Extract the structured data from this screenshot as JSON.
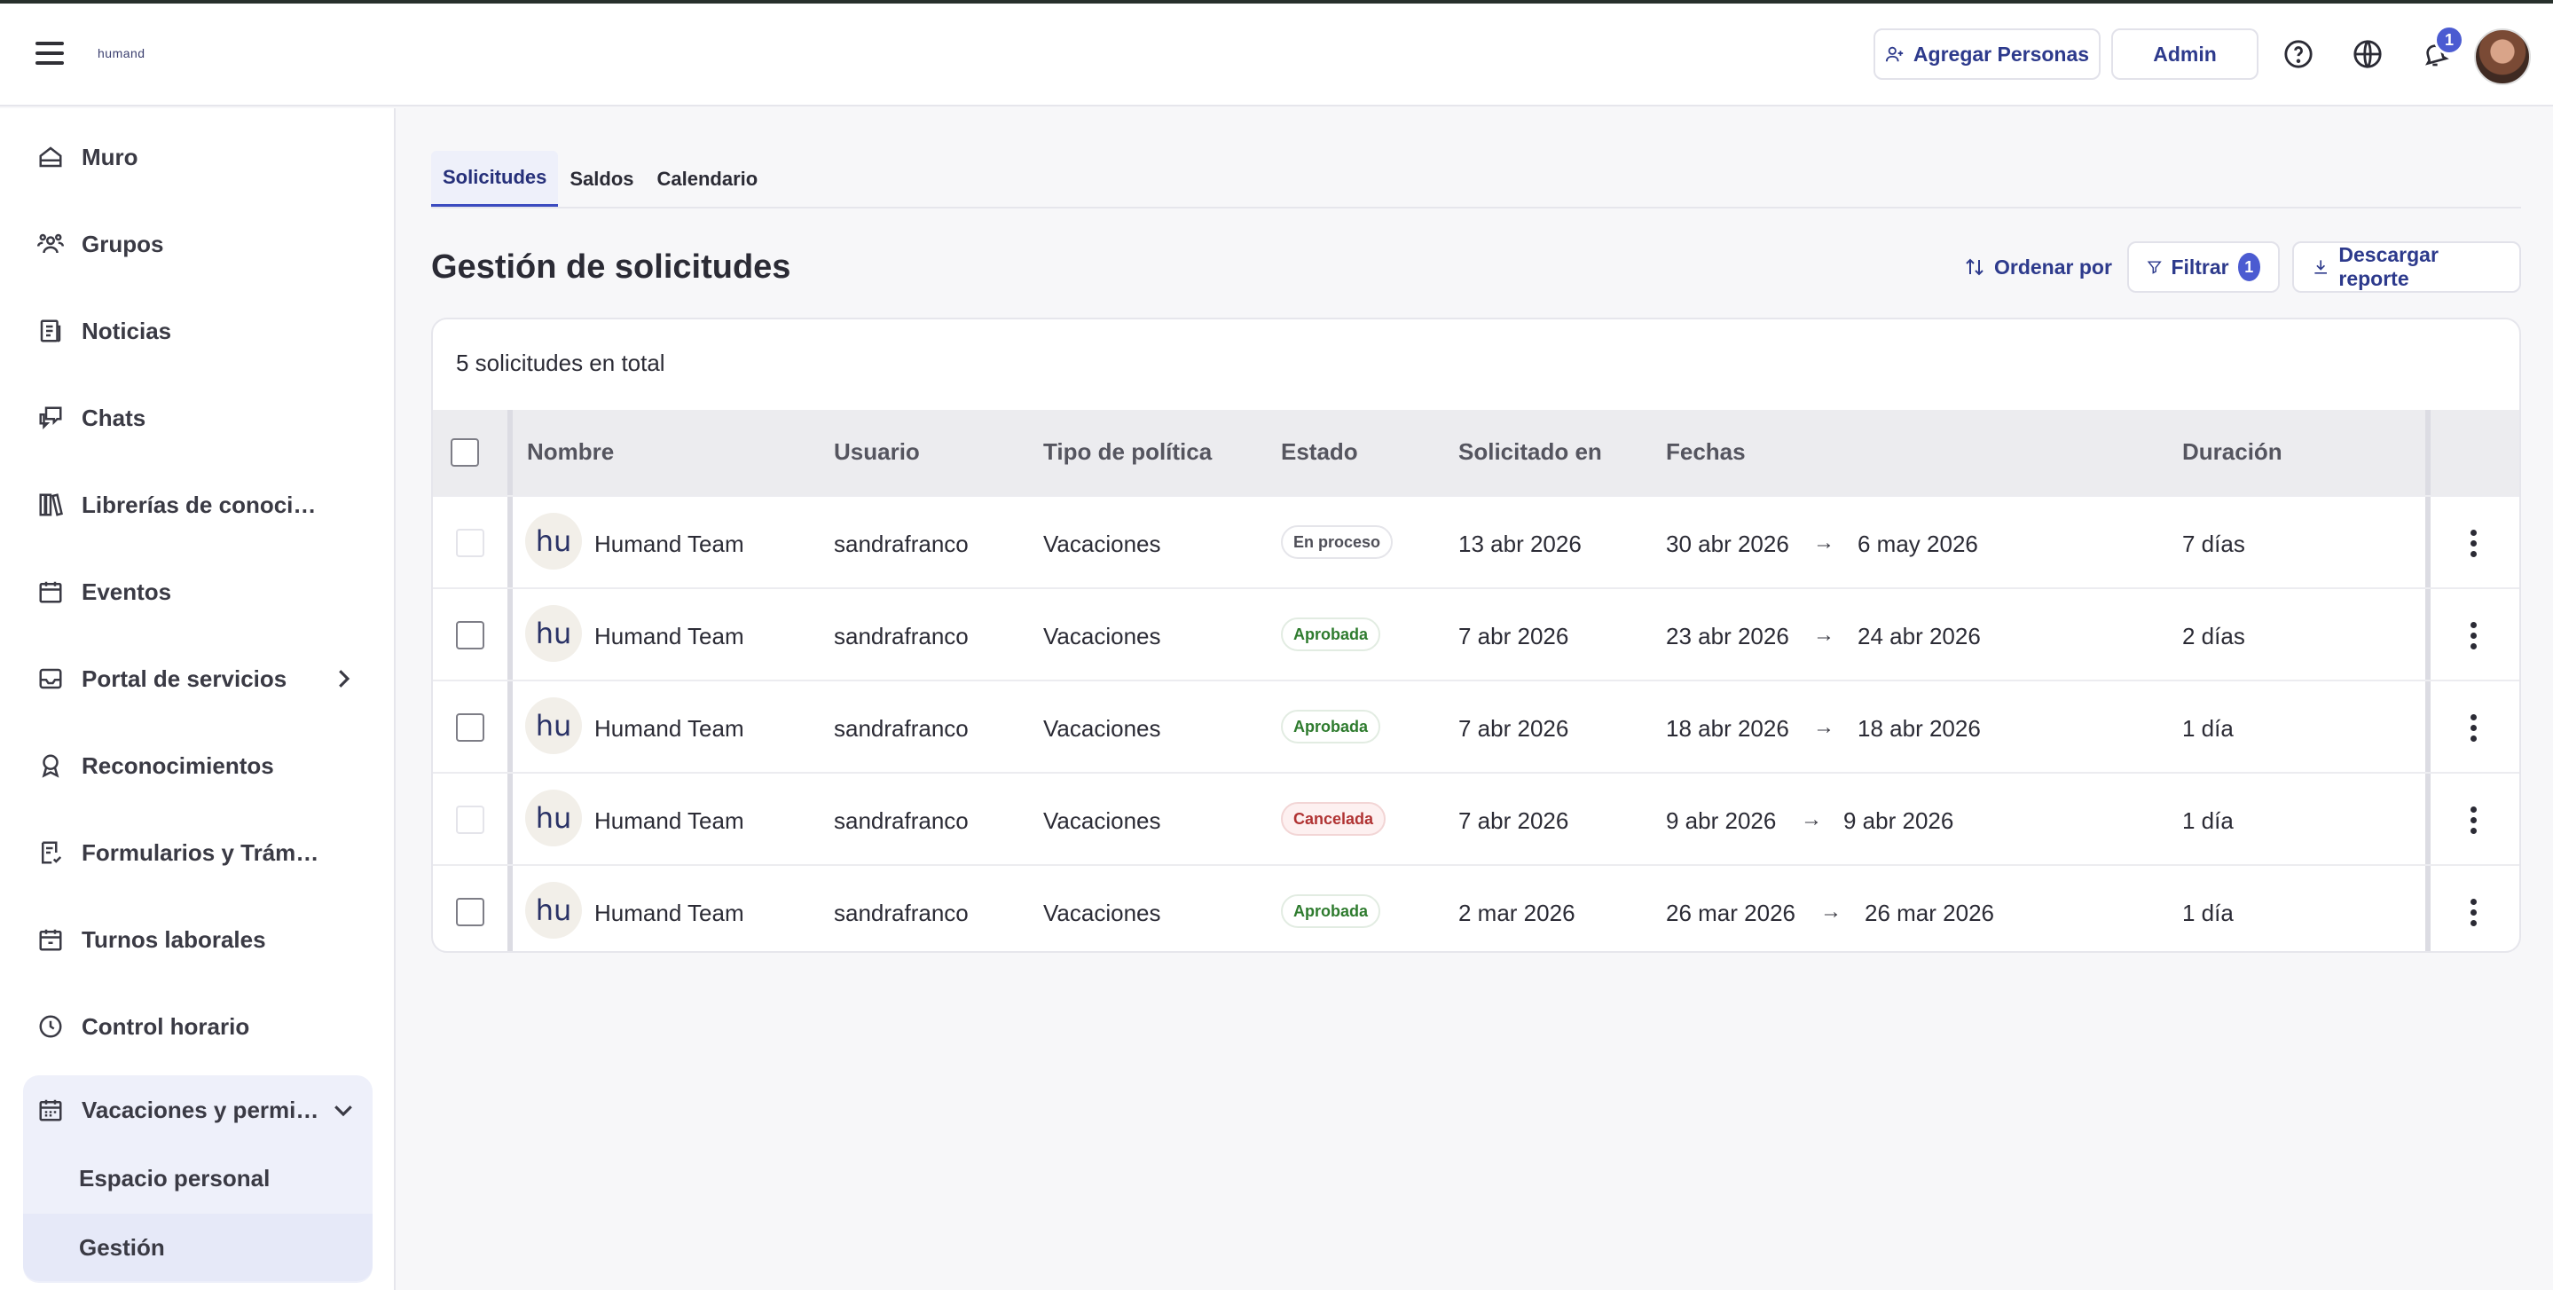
{
  "header": {
    "logo": "humand",
    "add_people_label": "Agregar Personas",
    "admin_label": "Admin",
    "notification_count": "1"
  },
  "sidebar": {
    "items": [
      {
        "label": "Muro",
        "icon": "home-icon"
      },
      {
        "label": "Grupos",
        "icon": "groups-icon"
      },
      {
        "label": "Noticias",
        "icon": "news-icon"
      },
      {
        "label": "Chats",
        "icon": "chats-icon"
      },
      {
        "label": "Librerías de conocimiento",
        "icon": "library-icon"
      },
      {
        "label": "Eventos",
        "icon": "calendar-icon"
      },
      {
        "label": "Portal de servicios",
        "icon": "inbox-icon"
      },
      {
        "label": "Reconocimientos",
        "icon": "award-icon"
      },
      {
        "label": "Formularios y Trámites",
        "icon": "form-icon"
      },
      {
        "label": "Turnos laborales",
        "icon": "calendar-icon"
      },
      {
        "label": "Control horario",
        "icon": "clock-icon"
      }
    ],
    "expanded": {
      "label": "Vacaciones y permis…",
      "children": [
        "Espacio personal",
        "Gestión"
      ]
    }
  },
  "tabs": [
    "Solicitudes",
    "Saldos",
    "Calendario"
  ],
  "page": {
    "title": "Gestión de solicitudes",
    "sort_label": "Ordenar por",
    "filter_label": "Filtrar",
    "filter_count": "1",
    "download_label": "Descargar reporte",
    "total_text": "5 solicitudes en total"
  },
  "table": {
    "columns": [
      "Nombre",
      "Usuario",
      "Tipo de política",
      "Estado",
      "Solicitado en",
      "Fechas",
      "Duración"
    ],
    "rows": [
      {
        "avatar": "hu",
        "name": "Humand Team",
        "user": "sandrafranco",
        "policy": "Vacaciones",
        "status": "En proceso",
        "requested": "13 abr 2026",
        "from": "30 abr 2026",
        "to": "6 may 2026",
        "duration": "7 días"
      },
      {
        "avatar": "hu",
        "name": "Humand Team",
        "user": "sandrafranco",
        "policy": "Vacaciones",
        "status": "Aprobada",
        "requested": "7 abr 2026",
        "from": "23 abr 2026",
        "to": "24 abr 2026",
        "duration": "2 días"
      },
      {
        "avatar": "hu",
        "name": "Humand Team",
        "user": "sandrafranco",
        "policy": "Vacaciones",
        "status": "Aprobada",
        "requested": "7 abr 2026",
        "from": "18 abr 2026",
        "to": "18 abr 2026",
        "duration": "1 día"
      },
      {
        "avatar": "hu",
        "name": "Humand Team",
        "user": "sandrafranco",
        "policy": "Vacaciones",
        "status": "Cancelada",
        "requested": "7 abr 2026",
        "from": "9 abr 2026",
        "to": "9 abr 2026",
        "duration": "1 día"
      },
      {
        "avatar": "hu",
        "name": "Humand Team",
        "user": "sandrafranco",
        "policy": "Vacaciones",
        "status": "Aprobada",
        "requested": "2 mar 2026",
        "from": "26 mar 2026",
        "to": "26 mar 2026",
        "duration": "1 día"
      }
    ],
    "arrow": "→"
  },
  "colors": {
    "accent": "#3b4bc0",
    "approved": "#2e7b2e",
    "cancelled": "#b03333",
    "badge": "#4b5bd1"
  }
}
